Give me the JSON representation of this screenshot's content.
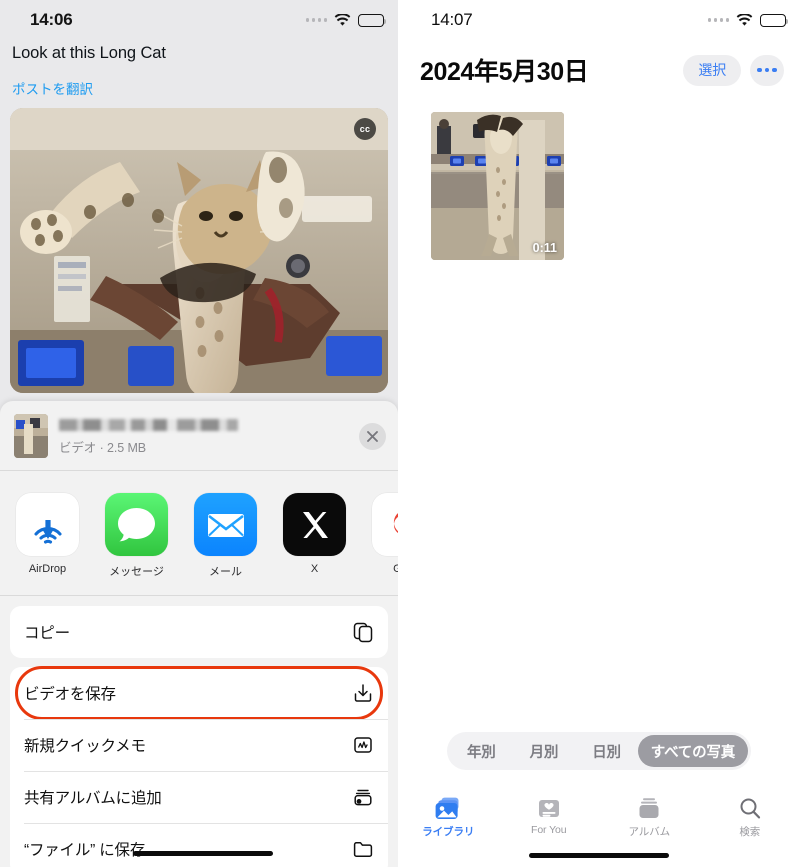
{
  "left_screen": {
    "status_bar": {
      "time": "14:06",
      "icons": [
        "signal-dots-icon",
        "wifi-icon",
        "battery-icon"
      ]
    },
    "post": {
      "text": "Look at this Long Cat",
      "translate_link": "ポストを翻訳",
      "media_badge": "cc"
    },
    "share_sheet": {
      "attachment": {
        "title_redacted": true,
        "subtitle": "ビデオ · 2.5 MB",
        "close_label": "✕"
      },
      "apps": [
        {
          "label": "AirDrop",
          "icon": "airdrop-icon"
        },
        {
          "label": "メッセージ",
          "icon": "messages-icon"
        },
        {
          "label": "メール",
          "icon": "mail-icon"
        },
        {
          "label": "X",
          "icon": "x-app-icon"
        },
        {
          "label": "Goo",
          "icon": "google-icon"
        }
      ],
      "actions": [
        {
          "label": "コピー",
          "icon": "copy-icon",
          "highlighted": false
        },
        {
          "label": "ビデオを保存",
          "icon": "download-icon",
          "highlighted": true
        },
        {
          "label": "新規クイックメモ",
          "icon": "quick-note-icon",
          "highlighted": false
        },
        {
          "label": "共有アルバムに追加",
          "icon": "shared-album-icon",
          "highlighted": false
        },
        {
          "label": "“ファイル” に保存",
          "icon": "folder-icon",
          "highlighted": false
        }
      ]
    }
  },
  "right_screen": {
    "status_bar": {
      "time": "14:07",
      "icons": [
        "signal-dots-icon",
        "wifi-icon",
        "battery-icon"
      ]
    },
    "header": {
      "title": "2024年5月30日",
      "select_label": "選択",
      "more_label": "more-options"
    },
    "grid": {
      "items": [
        {
          "duration": "0:11",
          "type": "video"
        }
      ]
    },
    "segmented_control": {
      "options": [
        "年別",
        "月別",
        "日別",
        "すべての写真"
      ],
      "selected": "すべての写真"
    },
    "tab_bar": {
      "tabs": [
        {
          "label": "ライブラリ",
          "icon": "photos-library-icon",
          "active": true
        },
        {
          "label": "For You",
          "icon": "for-you-icon",
          "active": false
        },
        {
          "label": "アルバム",
          "icon": "albums-icon",
          "active": false
        },
        {
          "label": "検索",
          "icon": "search-icon",
          "active": false
        }
      ]
    }
  },
  "colors": {
    "accent_blue": "#3b7ef3",
    "link_blue": "#1d9bf0",
    "highlight_red": "#e8380d",
    "sheet_bg": "#f2f2f2"
  }
}
